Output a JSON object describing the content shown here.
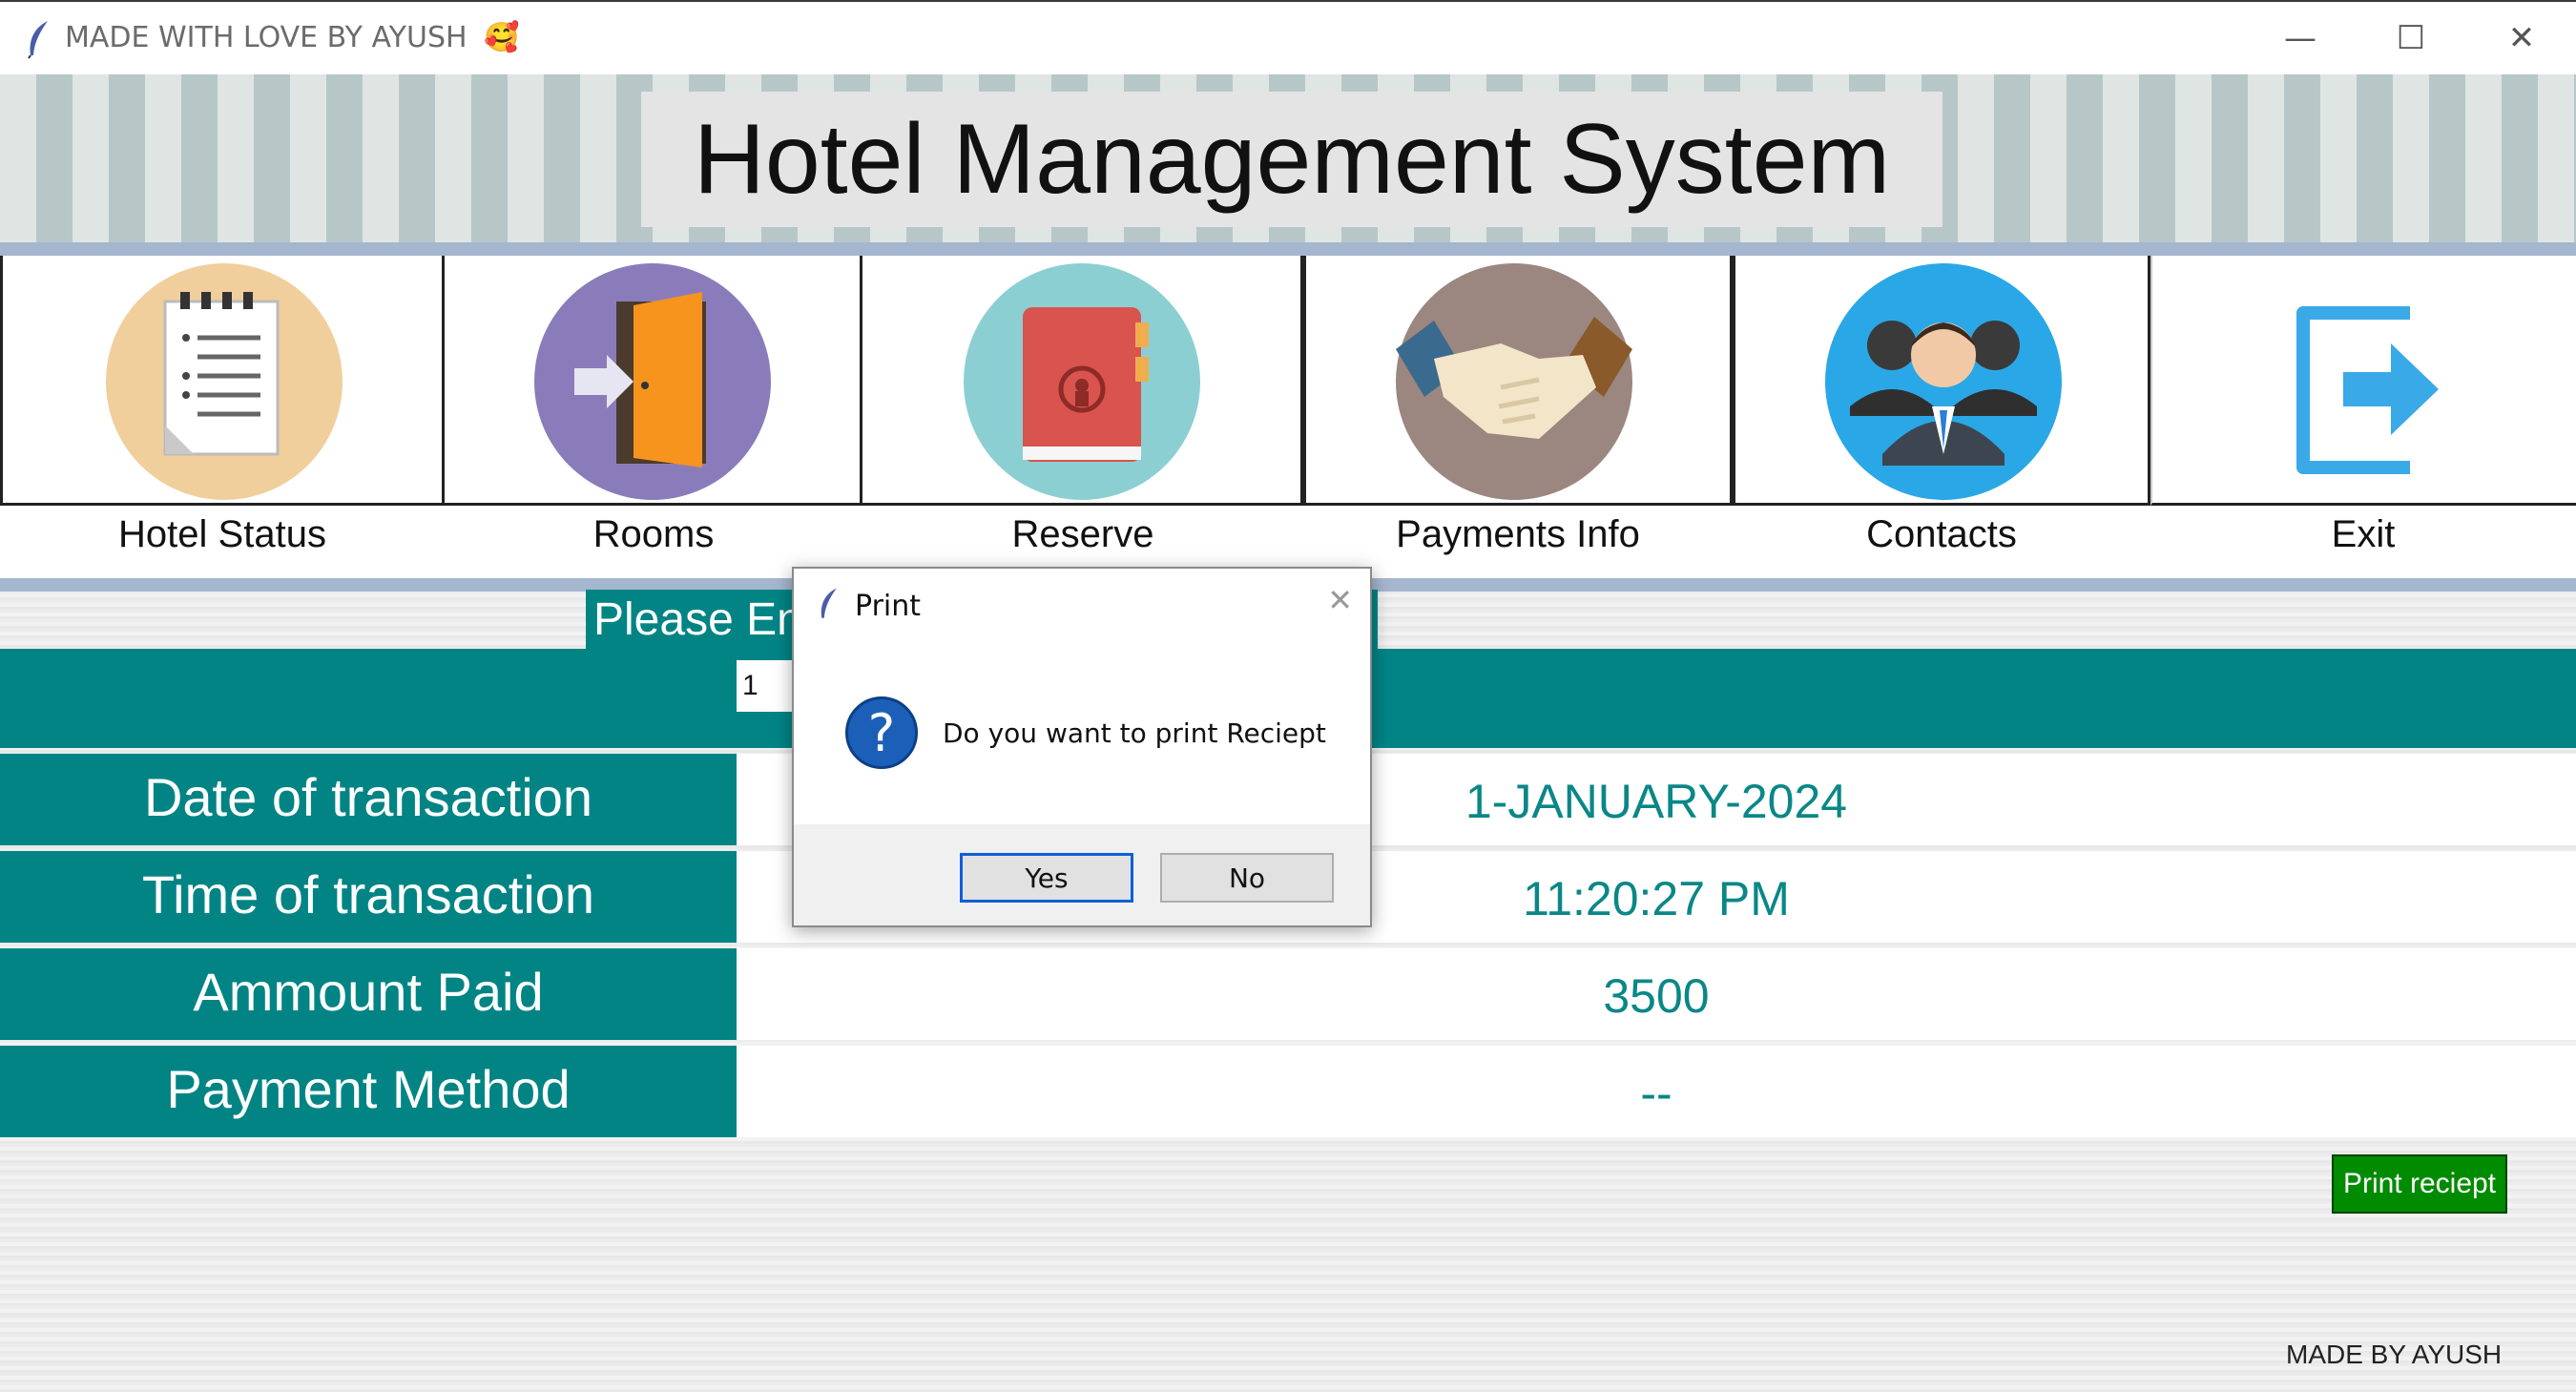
{
  "window": {
    "title": "MADE WITH LOVE BY AYUSH",
    "title_emoji": "🥰",
    "controls": {
      "minimize": "—",
      "maximize": "☐",
      "close": "✕"
    }
  },
  "header": {
    "title": "Hotel Management System"
  },
  "nav": {
    "items": [
      {
        "label": "Hotel Status",
        "icon": "notepad-icon",
        "color": "#f0cf9c"
      },
      {
        "label": "Rooms",
        "icon": "door-icon",
        "color": "#8a7cba"
      },
      {
        "label": "Reserve",
        "icon": "book-icon",
        "color": "#8ccfd2"
      },
      {
        "label": "Payments Info",
        "icon": "handshake-icon",
        "color": "#9b8780"
      },
      {
        "label": "Contacts",
        "icon": "people-icon",
        "color": "#2aa7e6"
      },
      {
        "label": "Exit",
        "icon": "exit-icon",
        "color": "#39a9e8"
      }
    ]
  },
  "form": {
    "prompt": "Please Enter Room Number",
    "room_value": "1",
    "rows": [
      {
        "label": "Date of transaction",
        "value": "1-JANUARY-2024"
      },
      {
        "label": "Time of transaction",
        "value": "11:20:27 PM"
      },
      {
        "label": "Ammount Paid",
        "value": "3500"
      },
      {
        "label": "Payment Method",
        "value": "--"
      }
    ],
    "print_button": "Print reciept",
    "footer": "MADE BY AYUSH"
  },
  "dialog": {
    "title": "Print",
    "close": "✕",
    "icon": "question-icon",
    "message": "Do you want to print Reciept",
    "yes": "Yes",
    "no": "No"
  }
}
